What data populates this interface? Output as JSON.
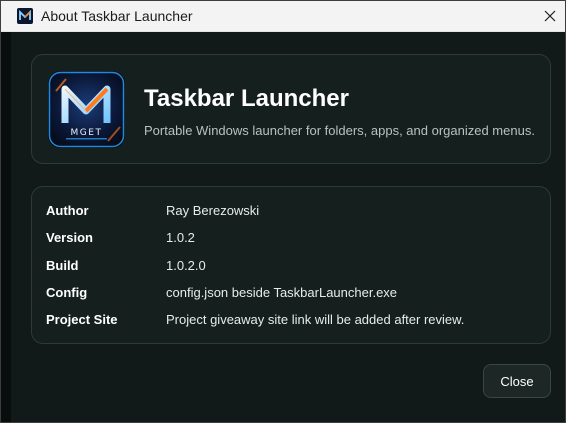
{
  "window": {
    "title": "About Taskbar Launcher",
    "icon": "app-logo-icon",
    "close_icon": "close-icon"
  },
  "header": {
    "logo_icon": "mget-logo-icon",
    "logo_text": "MGET",
    "title": "Taskbar Launcher",
    "subtitle": "Portable Windows launcher for folders, apps, and organized menus."
  },
  "info": {
    "rows": [
      {
        "label": "Author",
        "value": "Ray Berezowski"
      },
      {
        "label": "Version",
        "value": "1.0.2"
      },
      {
        "label": "Build",
        "value": "1.0.2.0"
      },
      {
        "label": "Config",
        "value": "config.json beside TaskbarLauncher.exe"
      },
      {
        "label": "Project Site",
        "value": "Project giveaway site link will be added after review."
      }
    ]
  },
  "footer": {
    "close_label": "Close"
  },
  "colors": {
    "background": "#111a18",
    "card": "#15201e",
    "card_border": "#2d3a37",
    "accent_blue": "#2aa7ff",
    "accent_orange": "#ff7a1a"
  }
}
